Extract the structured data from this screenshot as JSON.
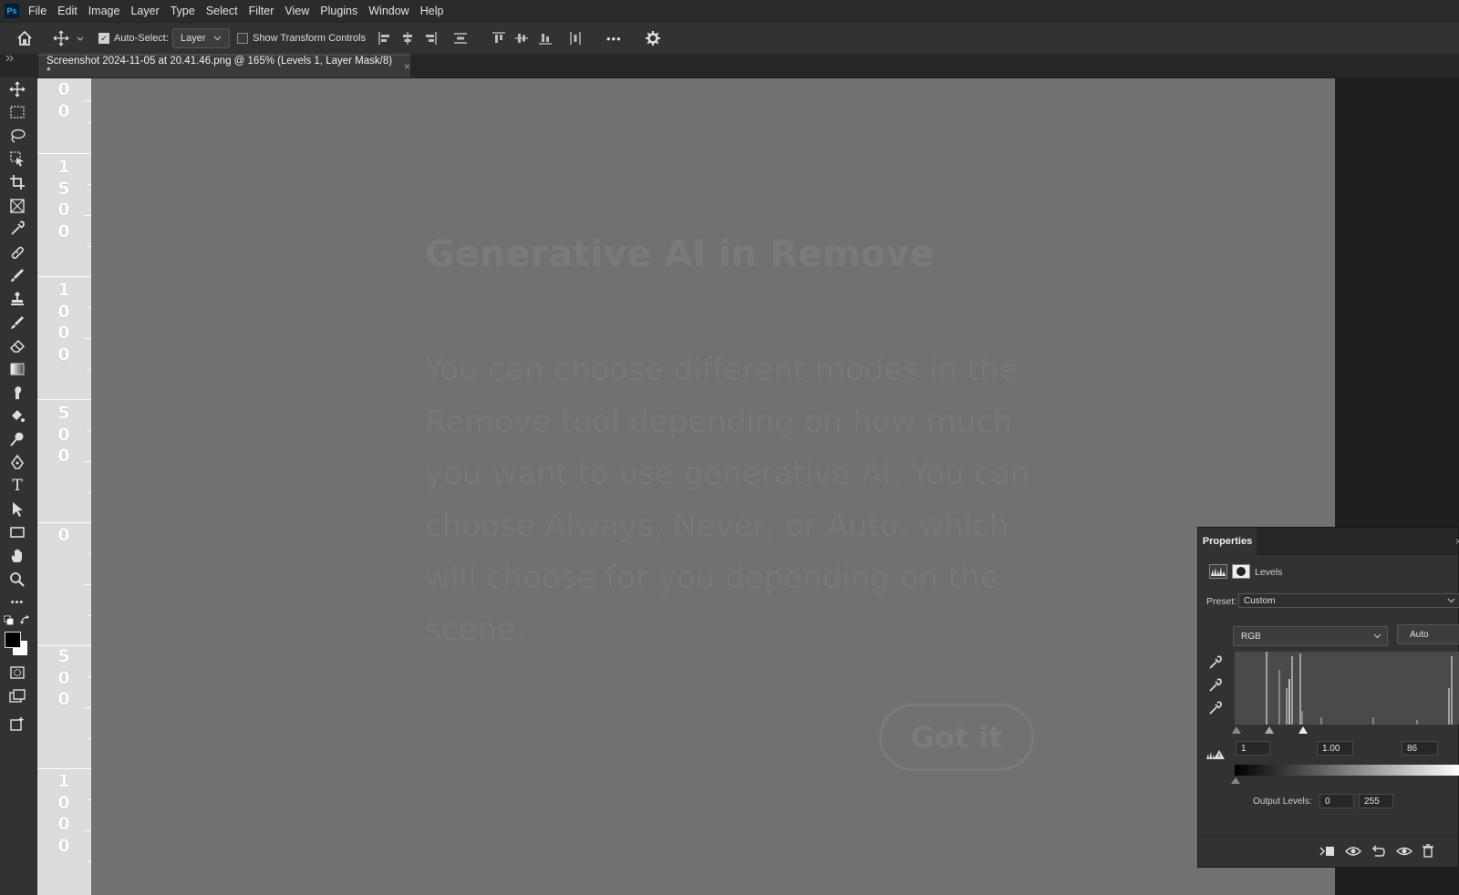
{
  "app": {
    "logo_text": "Ps"
  },
  "menu": [
    "File",
    "Edit",
    "Image",
    "Layer",
    "Type",
    "Select",
    "Filter",
    "View",
    "Plugins",
    "Window",
    "Help"
  ],
  "options_bar": {
    "auto_select_label": "Auto-Select:",
    "auto_select_checked": true,
    "layer_dropdown": "Layer",
    "show_transform_label": "Show Transform Controls",
    "show_transform_checked": false,
    "more_glyph": "•••"
  },
  "tabs": [
    {
      "title": "Screenshot 2024-11-05 at 20.41.46.png @ 165% (Levels 1, Layer Mask/8) *",
      "close_glyph": "×"
    }
  ],
  "toolbar": {
    "tools": [
      "move-tool",
      "rectangular-marquee-tool",
      "lasso-tool",
      "object-selection-tool",
      "crop-tool",
      "frame-tool",
      "eyedropper-tool",
      "spot-healing-tool",
      "brush-tool",
      "clone-stamp-tool",
      "history-brush-tool",
      "eraser-tool",
      "gradient-tool",
      "smudge-tool",
      "paint-bucket-tool",
      "dodge-tool",
      "pen-tool",
      "type-tool",
      "path-selection-tool",
      "rectangle-tool",
      "hand-tool",
      "zoom-tool",
      "edit-toolbar"
    ],
    "type_glyph": "T",
    "more_glyph": "•••"
  },
  "ruler": {
    "labels": [
      {
        "text": "0\n0"
      },
      {
        "text": "1\n5\n0\n0"
      },
      {
        "text": "1\n0\n0\n0"
      },
      {
        "text": "5\n0\n0"
      },
      {
        "text": "0"
      },
      {
        "text": "5\n0\n0"
      },
      {
        "text": "1\n0\n0\n0"
      }
    ]
  },
  "canvas": {
    "title": "Generative AI in Remove",
    "body": "You can choose different modes in the Remove tool depending on how much you want to use generative AI. You can choose Always, Never, or Auto, which will choose for you depending on the scene.",
    "button": "Got it"
  },
  "properties": {
    "title": "Properties",
    "close_glyph": "×",
    "layer_type": "Levels",
    "preset_label": "Preset:",
    "preset_value": "Custom",
    "channel_value": "RGB",
    "auto_label": "Auto",
    "input_black": "1",
    "input_gamma": "1.00",
    "input_white": "86",
    "output_label": "Output Levels:",
    "output_black": "0",
    "output_white": "255"
  }
}
